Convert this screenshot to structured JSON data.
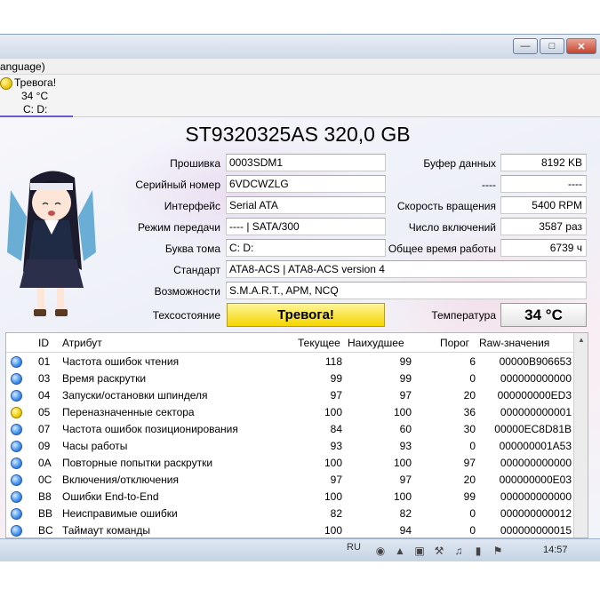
{
  "menubar": {
    "text": "anguage)"
  },
  "drive_tab": {
    "status": "Тревога!",
    "temperature": "34 °C",
    "letter": "C: D:"
  },
  "model": "ST9320325AS 320,0 GB",
  "info": {
    "firmware_label": "Прошивка",
    "firmware": "0003SDM1",
    "serial_label": "Серийный номер",
    "serial": "6VDCWZLG",
    "interface_label": "Интерфейс",
    "interface": "Serial ATA",
    "transfer_label": "Режим передачи",
    "transfer": "---- | SATA/300",
    "letter_label": "Буква тома",
    "letter": "C: D:",
    "standard_label": "Стандарт",
    "standard": "ATA8-ACS | ATA8-ACS version 4",
    "features_label": "Возможности",
    "features": "S.M.A.R.T., APM, NCQ",
    "buffer_label": "Буфер данных",
    "buffer": "8192 KB",
    "blank_label": "----",
    "blank": "----",
    "rpm_label": "Скорость вращения",
    "rpm": "5400 RPM",
    "power_count_label": "Число включений",
    "power_count": "3587 раз",
    "power_hours_label": "Общее время работы",
    "power_hours": "6739 ч"
  },
  "health": {
    "label": "Техсостояние",
    "value": "Тревога!"
  },
  "temperature": {
    "label": "Температура",
    "value": "34 °C"
  },
  "smart": {
    "columns": [
      "ID",
      "Атрибут",
      "Текущее",
      "Наихудшее",
      "Порог",
      "Raw-значения"
    ],
    "rows": [
      {
        "status": "blue",
        "id": "01",
        "name": "Частота ошибок чтения",
        "current": "118",
        "worst": "99",
        "threshold": "6",
        "raw": "00000B906653"
      },
      {
        "status": "blue",
        "id": "03",
        "name": "Время раскрутки",
        "current": "99",
        "worst": "99",
        "threshold": "0",
        "raw": "000000000000"
      },
      {
        "status": "blue",
        "id": "04",
        "name": "Запуски/остановки шпинделя",
        "current": "97",
        "worst": "97",
        "threshold": "20",
        "raw": "000000000ED3"
      },
      {
        "status": "yellow",
        "id": "05",
        "name": "Переназначенные сектора",
        "current": "100",
        "worst": "100",
        "threshold": "36",
        "raw": "000000000001"
      },
      {
        "status": "blue",
        "id": "07",
        "name": "Частота ошибок позиционирования",
        "current": "84",
        "worst": "60",
        "threshold": "30",
        "raw": "00000EC8D81B"
      },
      {
        "status": "blue",
        "id": "09",
        "name": "Часы работы",
        "current": "93",
        "worst": "93",
        "threshold": "0",
        "raw": "000000001A53"
      },
      {
        "status": "blue",
        "id": "0A",
        "name": "Повторные попытки раскрутки",
        "current": "100",
        "worst": "100",
        "threshold": "97",
        "raw": "000000000000"
      },
      {
        "status": "blue",
        "id": "0C",
        "name": "Включения/отключения",
        "current": "97",
        "worst": "97",
        "threshold": "20",
        "raw": "000000000E03"
      },
      {
        "status": "blue",
        "id": "B8",
        "name": "Ошибки End-to-End",
        "current": "100",
        "worst": "100",
        "threshold": "99",
        "raw": "000000000000"
      },
      {
        "status": "blue",
        "id": "BB",
        "name": "Неисправимые ошибки",
        "current": "82",
        "worst": "82",
        "threshold": "0",
        "raw": "000000000012"
      },
      {
        "status": "blue",
        "id": "BC",
        "name": "Таймаут команды",
        "current": "100",
        "worst": "94",
        "threshold": "0",
        "raw": "000000000015"
      }
    ]
  },
  "taskbar": {
    "lang": "RU",
    "clock": "14:57"
  },
  "colors": {
    "alarm_yellow": "#f4d400",
    "good_blue": "#3f8fe8"
  }
}
